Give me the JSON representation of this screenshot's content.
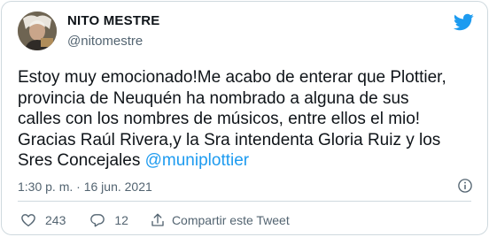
{
  "tweet": {
    "author": {
      "display_name": "NITO MESTRE",
      "handle": "@nitomestre",
      "avatar_icon": "user-avatar"
    },
    "brand_icon": "twitter-bird-icon",
    "brand_color": "#1d9bf0",
    "text": "Estoy muy emocionado!Me acabo de enterar que Plottier,\nprovincia de Neuquén ha nombrado a alguna de sus\ncalles con los nombres de músicos, entre ellos el mio!\nGracias Raúl Rivera,y la Sra intendenta Gloria Ruiz y los\nSres Concejales ",
    "mention": "@muniplottier",
    "mention_color": "#1d9bf0",
    "time": "1:30 p. m.",
    "separator": " · ",
    "date": "16 jun. 2021",
    "info_icon": "info-icon"
  },
  "actions": {
    "like": {
      "icon": "heart-icon",
      "count": "243"
    },
    "reply": {
      "icon": "speech-bubble-icon",
      "count": "12"
    },
    "share": {
      "icon": "share-arrow-icon",
      "label": "Compartir este Tweet"
    }
  },
  "colors": {
    "text_primary": "#0f1419",
    "text_secondary": "#536471",
    "border": "#cfd9de"
  }
}
